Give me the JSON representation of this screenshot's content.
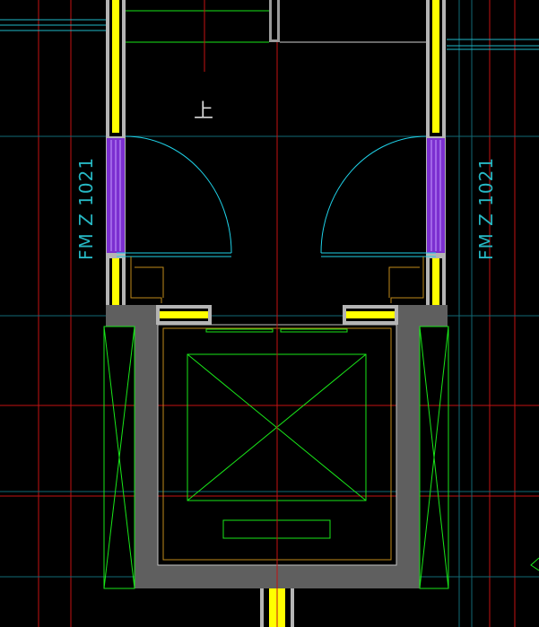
{
  "drawing": {
    "up_label": "上",
    "door_tags": {
      "left": "FM Z 1021",
      "right": "FM Z 1021"
    }
  },
  "colors": {
    "background": "#000000",
    "axis_red": "#cc1111",
    "axis_cyan": "#1a7b88",
    "door_cyan": "#1fd0e6",
    "wall_gray": "#b4b4b4",
    "shaft_gray": "#5f5f5f",
    "window_yellow": "#ffff00",
    "fire_door_purple": "#7b2fd0",
    "elevator_green": "#19e619",
    "orange": "#c08a1a"
  }
}
